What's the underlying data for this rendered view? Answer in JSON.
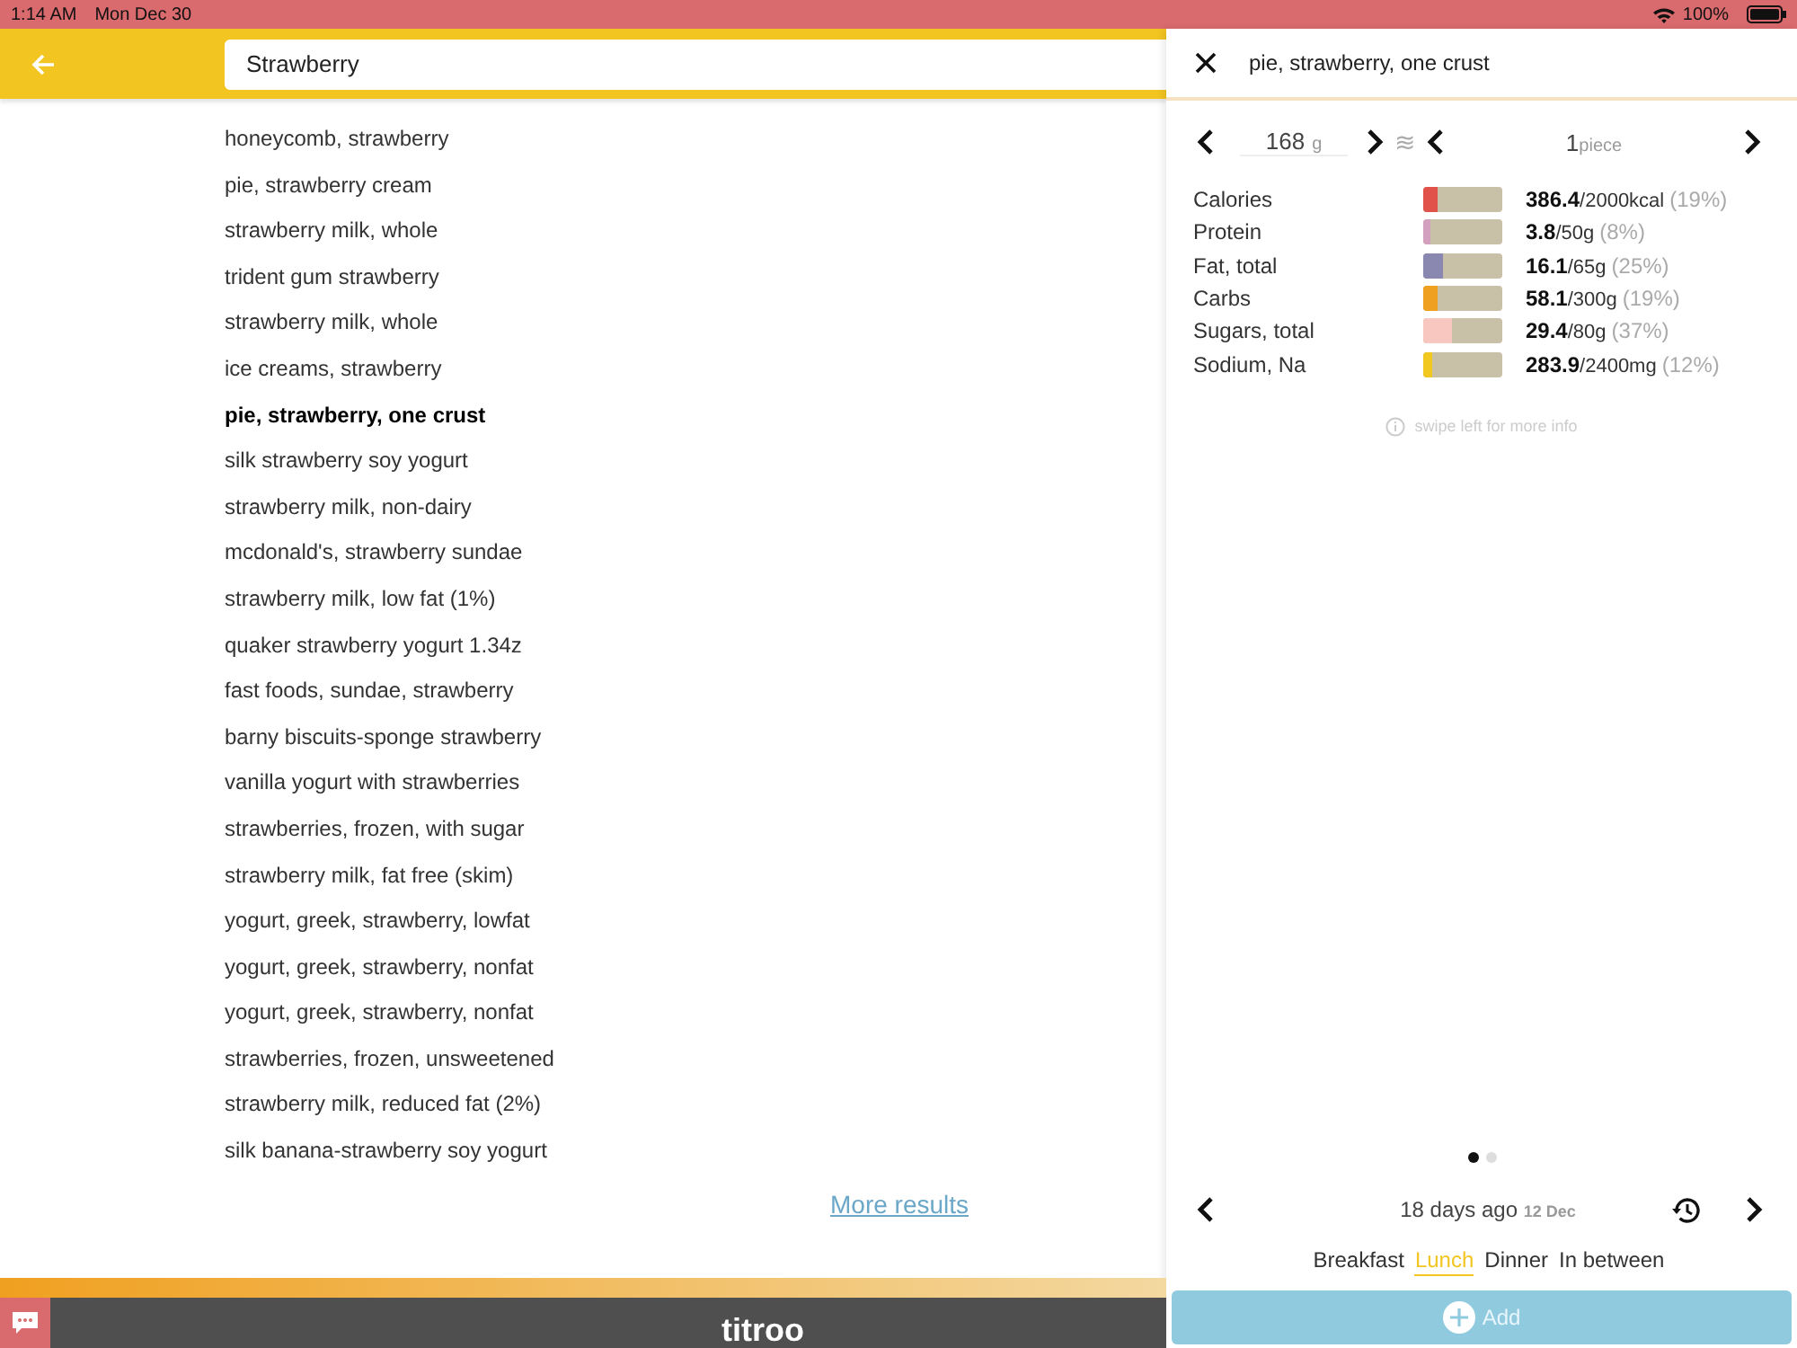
{
  "status_bar": {
    "time": "1:14 AM",
    "date": "Mon Dec 30",
    "battery": "100%"
  },
  "search": {
    "value": "Strawberry"
  },
  "results": [
    {
      "label": "honeycomb, strawberry",
      "selected": false
    },
    {
      "label": "pie, strawberry cream",
      "selected": false
    },
    {
      "label": "strawberry milk, whole",
      "selected": false
    },
    {
      "label": "trident gum strawberry",
      "selected": false
    },
    {
      "label": "strawberry milk, whole",
      "selected": false
    },
    {
      "label": "ice creams, strawberry",
      "selected": false
    },
    {
      "label": "pie, strawberry, one crust",
      "selected": true
    },
    {
      "label": "silk strawberry soy yogurt",
      "selected": false
    },
    {
      "label": "strawberry milk, non-dairy",
      "selected": false
    },
    {
      "label": "mcdonald's, strawberry sundae",
      "selected": false
    },
    {
      "label": "strawberry milk, low fat (1%)",
      "selected": false
    },
    {
      "label": "quaker strawberry yogurt 1.34z",
      "selected": false
    },
    {
      "label": "fast foods, sundae, strawberry",
      "selected": false
    },
    {
      "label": "barny biscuits-sponge strawberry",
      "selected": false
    },
    {
      "label": "vanilla yogurt with strawberries",
      "selected": false
    },
    {
      "label": "strawberries, frozen, with sugar",
      "selected": false
    },
    {
      "label": "strawberry milk, fat free (skim)",
      "selected": false
    },
    {
      "label": "yogurt, greek, strawberry, lowfat",
      "selected": false
    },
    {
      "label": "yogurt, greek, strawberry, nonfat",
      "selected": false
    },
    {
      "label": "yogurt, greek, strawberry, nonfat",
      "selected": false
    },
    {
      "label": "strawberries, frozen, unsweetened",
      "selected": false
    },
    {
      "label": "strawberry milk, reduced fat (2%)",
      "selected": false
    },
    {
      "label": "silk banana-strawberry soy yogurt",
      "selected": false
    }
  ],
  "more_results": "More results",
  "footer": {
    "logo": "titroo"
  },
  "detail": {
    "title": "pie, strawberry, one crust",
    "weight": {
      "value": "168",
      "unit": "g"
    },
    "approx": "≋",
    "portion": {
      "value": "1",
      "unit": "piece"
    },
    "nutrients": [
      {
        "label": "Calories",
        "color": "#e0524a",
        "level": 0.19,
        "amount": "**386.4**/2000kcal",
        "percent": "(19%)"
      },
      {
        "label": "Protein",
        "color": "#d4a0c0",
        "level": 0.08,
        "amount": "**3.8**/50g",
        "percent": "(8%)"
      },
      {
        "label": "Fat, total",
        "color": "#8a88b0",
        "level": 0.25,
        "amount": "**16.1**/65g",
        "percent": "(25%)"
      },
      {
        "label": "Carbs",
        "color": "#f0a020",
        "level": 0.19,
        "amount": "**58.1**/300g",
        "percent": "(19%)"
      },
      {
        "label": "Sugars, total",
        "color": "#f8c8c0",
        "level": 0.37,
        "amount": "**29.4**/80g",
        "percent": "(37%)"
      },
      {
        "label": "Sodium, Na",
        "color": "#f0c820",
        "level": 0.12,
        "amount": "**283.9**/2400mg",
        "percent": "(12%)"
      }
    ],
    "hint": "swipe left for more info",
    "pages": [
      {
        "selected": true
      },
      {
        "selected": false
      }
    ],
    "date": {
      "relative": "18 days ago",
      "day": "12 Dec"
    },
    "meals": [
      {
        "label": "Breakfast",
        "selected": false
      },
      {
        "label": "Lunch",
        "selected": true
      },
      {
        "label": "Dinner",
        "selected": false
      },
      {
        "label": "In between",
        "selected": false
      }
    ],
    "add_button": "Add"
  }
}
